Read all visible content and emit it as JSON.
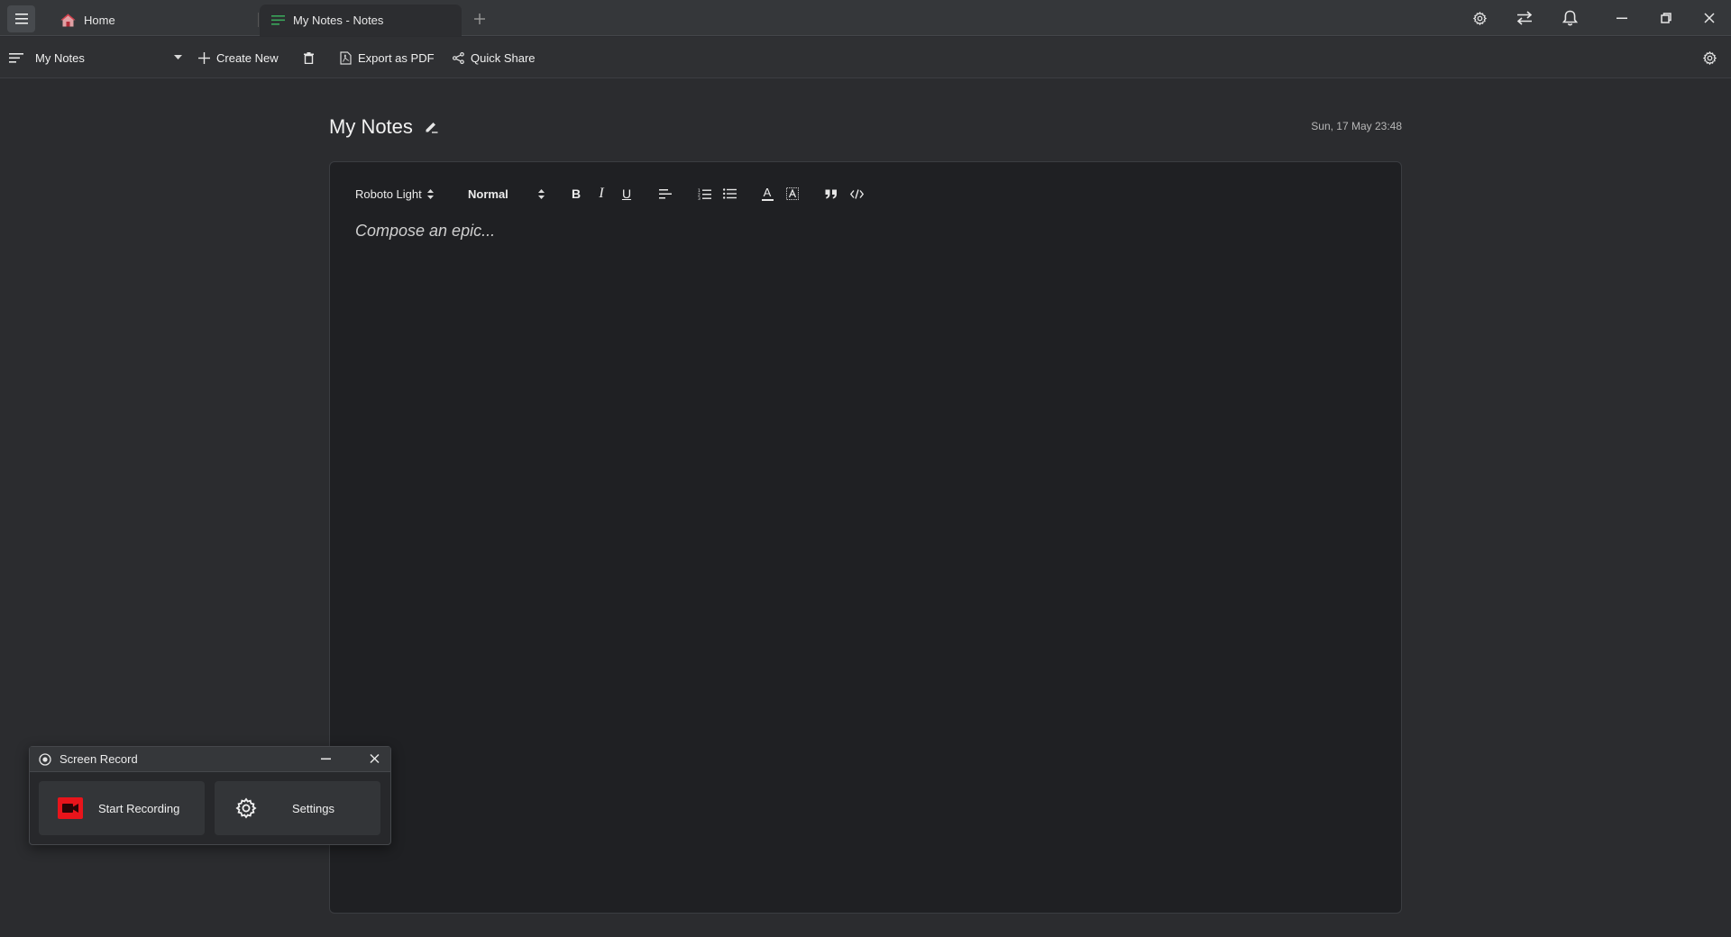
{
  "tabs": [
    {
      "label": "Home",
      "icon": "home-icon",
      "active": false
    },
    {
      "label": "My Notes - Notes",
      "icon": "notes-icon",
      "active": true
    }
  ],
  "toolbar": {
    "notebook": "My Notes",
    "create_new": "Create New",
    "export_pdf": "Export as PDF",
    "quick_share": "Quick Share"
  },
  "note": {
    "title": "My Notes",
    "date": "Sun, 17 May 23:48",
    "placeholder": "Compose an epic..."
  },
  "format_bar": {
    "font": "Roboto Light",
    "size": "Normal",
    "bold": "B",
    "italic": "I",
    "underline": "U",
    "color_letter": "A"
  },
  "screen_record": {
    "title": "Screen Record",
    "start": "Start Recording",
    "settings": "Settings"
  },
  "colors": {
    "accent_green": "#3aa65a",
    "record_red": "#e8141b",
    "background": "#2b2c2f",
    "editor_bg": "#1f2023"
  }
}
